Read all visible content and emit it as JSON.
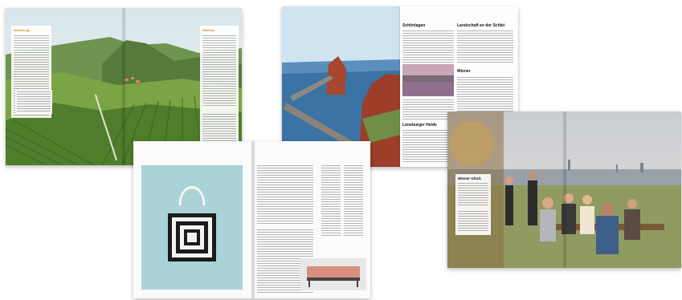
{
  "image": {
    "description_labels": {
      "spread_1_left_heading": "Weinberge",
      "spread_1_right_heading": "Wachau",
      "spread_2_heading_a": "Schönlagen",
      "spread_2_heading_b": "Landschaft an der Schlei",
      "spread_2_heading_c": "Lüneburger Heide",
      "spread_2_heading_d": "Wiener",
      "spread_3_heading": "Wiener Glück",
      "tag_label": "Wien"
    },
    "colors": {
      "accent_orange": "#e98a2b",
      "poster_teal": "#a9d3d6",
      "sea_blue": "#3a73a4",
      "vine_green": "#5f8b35"
    }
  }
}
